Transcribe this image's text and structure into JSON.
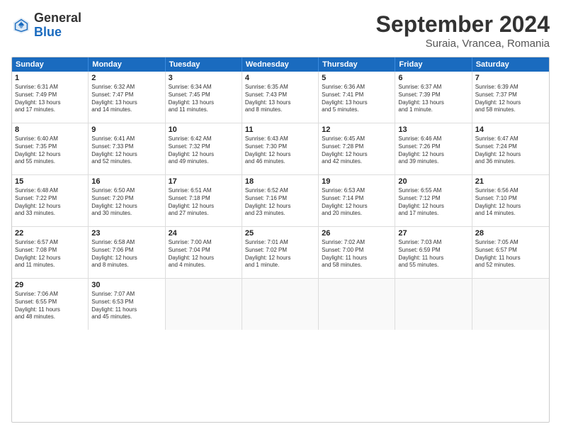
{
  "header": {
    "logo_general": "General",
    "logo_blue": "Blue",
    "month_year": "September 2024",
    "location": "Suraia, Vrancea, Romania"
  },
  "calendar": {
    "days_of_week": [
      "Sunday",
      "Monday",
      "Tuesday",
      "Wednesday",
      "Thursday",
      "Friday",
      "Saturday"
    ],
    "rows": [
      [
        {
          "day": "",
          "empty": true
        },
        {
          "day": "",
          "empty": true
        },
        {
          "day": "",
          "empty": true
        },
        {
          "day": "",
          "empty": true
        },
        {
          "day": "",
          "empty": true
        },
        {
          "day": "",
          "empty": true
        },
        {
          "day": "",
          "empty": true
        }
      ]
    ],
    "cells": [
      [
        {
          "day": "1",
          "lines": [
            "Sunrise: 6:31 AM",
            "Sunset: 7:49 PM",
            "Daylight: 13 hours",
            "and 17 minutes."
          ]
        },
        {
          "day": "2",
          "lines": [
            "Sunrise: 6:32 AM",
            "Sunset: 7:47 PM",
            "Daylight: 13 hours",
            "and 14 minutes."
          ]
        },
        {
          "day": "3",
          "lines": [
            "Sunrise: 6:34 AM",
            "Sunset: 7:45 PM",
            "Daylight: 13 hours",
            "and 11 minutes."
          ]
        },
        {
          "day": "4",
          "lines": [
            "Sunrise: 6:35 AM",
            "Sunset: 7:43 PM",
            "Daylight: 13 hours",
            "and 8 minutes."
          ]
        },
        {
          "day": "5",
          "lines": [
            "Sunrise: 6:36 AM",
            "Sunset: 7:41 PM",
            "Daylight: 13 hours",
            "and 5 minutes."
          ]
        },
        {
          "day": "6",
          "lines": [
            "Sunrise: 6:37 AM",
            "Sunset: 7:39 PM",
            "Daylight: 13 hours",
            "and 1 minute."
          ]
        },
        {
          "day": "7",
          "lines": [
            "Sunrise: 6:39 AM",
            "Sunset: 7:37 PM",
            "Daylight: 12 hours",
            "and 58 minutes."
          ]
        }
      ],
      [
        {
          "day": "8",
          "lines": [
            "Sunrise: 6:40 AM",
            "Sunset: 7:35 PM",
            "Daylight: 12 hours",
            "and 55 minutes."
          ]
        },
        {
          "day": "9",
          "lines": [
            "Sunrise: 6:41 AM",
            "Sunset: 7:33 PM",
            "Daylight: 12 hours",
            "and 52 minutes."
          ]
        },
        {
          "day": "10",
          "lines": [
            "Sunrise: 6:42 AM",
            "Sunset: 7:32 PM",
            "Daylight: 12 hours",
            "and 49 minutes."
          ]
        },
        {
          "day": "11",
          "lines": [
            "Sunrise: 6:43 AM",
            "Sunset: 7:30 PM",
            "Daylight: 12 hours",
            "and 46 minutes."
          ]
        },
        {
          "day": "12",
          "lines": [
            "Sunrise: 6:45 AM",
            "Sunset: 7:28 PM",
            "Daylight: 12 hours",
            "and 42 minutes."
          ]
        },
        {
          "day": "13",
          "lines": [
            "Sunrise: 6:46 AM",
            "Sunset: 7:26 PM",
            "Daylight: 12 hours",
            "and 39 minutes."
          ]
        },
        {
          "day": "14",
          "lines": [
            "Sunrise: 6:47 AM",
            "Sunset: 7:24 PM",
            "Daylight: 12 hours",
            "and 36 minutes."
          ]
        }
      ],
      [
        {
          "day": "15",
          "lines": [
            "Sunrise: 6:48 AM",
            "Sunset: 7:22 PM",
            "Daylight: 12 hours",
            "and 33 minutes."
          ]
        },
        {
          "day": "16",
          "lines": [
            "Sunrise: 6:50 AM",
            "Sunset: 7:20 PM",
            "Daylight: 12 hours",
            "and 30 minutes."
          ]
        },
        {
          "day": "17",
          "lines": [
            "Sunrise: 6:51 AM",
            "Sunset: 7:18 PM",
            "Daylight: 12 hours",
            "and 27 minutes."
          ]
        },
        {
          "day": "18",
          "lines": [
            "Sunrise: 6:52 AM",
            "Sunset: 7:16 PM",
            "Daylight: 12 hours",
            "and 23 minutes."
          ]
        },
        {
          "day": "19",
          "lines": [
            "Sunrise: 6:53 AM",
            "Sunset: 7:14 PM",
            "Daylight: 12 hours",
            "and 20 minutes."
          ]
        },
        {
          "day": "20",
          "lines": [
            "Sunrise: 6:55 AM",
            "Sunset: 7:12 PM",
            "Daylight: 12 hours",
            "and 17 minutes."
          ]
        },
        {
          "day": "21",
          "lines": [
            "Sunrise: 6:56 AM",
            "Sunset: 7:10 PM",
            "Daylight: 12 hours",
            "and 14 minutes."
          ]
        }
      ],
      [
        {
          "day": "22",
          "lines": [
            "Sunrise: 6:57 AM",
            "Sunset: 7:08 PM",
            "Daylight: 12 hours",
            "and 11 minutes."
          ]
        },
        {
          "day": "23",
          "lines": [
            "Sunrise: 6:58 AM",
            "Sunset: 7:06 PM",
            "Daylight: 12 hours",
            "and 8 minutes."
          ]
        },
        {
          "day": "24",
          "lines": [
            "Sunrise: 7:00 AM",
            "Sunset: 7:04 PM",
            "Daylight: 12 hours",
            "and 4 minutes."
          ]
        },
        {
          "day": "25",
          "lines": [
            "Sunrise: 7:01 AM",
            "Sunset: 7:02 PM",
            "Daylight: 12 hours",
            "and 1 minute."
          ]
        },
        {
          "day": "26",
          "lines": [
            "Sunrise: 7:02 AM",
            "Sunset: 7:00 PM",
            "Daylight: 11 hours",
            "and 58 minutes."
          ]
        },
        {
          "day": "27",
          "lines": [
            "Sunrise: 7:03 AM",
            "Sunset: 6:59 PM",
            "Daylight: 11 hours",
            "and 55 minutes."
          ]
        },
        {
          "day": "28",
          "lines": [
            "Sunrise: 7:05 AM",
            "Sunset: 6:57 PM",
            "Daylight: 11 hours",
            "and 52 minutes."
          ]
        }
      ],
      [
        {
          "day": "29",
          "lines": [
            "Sunrise: 7:06 AM",
            "Sunset: 6:55 PM",
            "Daylight: 11 hours",
            "and 48 minutes."
          ]
        },
        {
          "day": "30",
          "lines": [
            "Sunrise: 7:07 AM",
            "Sunset: 6:53 PM",
            "Daylight: 11 hours",
            "and 45 minutes."
          ]
        },
        {
          "day": "",
          "empty": true
        },
        {
          "day": "",
          "empty": true
        },
        {
          "day": "",
          "empty": true
        },
        {
          "day": "",
          "empty": true
        },
        {
          "day": "",
          "empty": true
        }
      ]
    ]
  }
}
